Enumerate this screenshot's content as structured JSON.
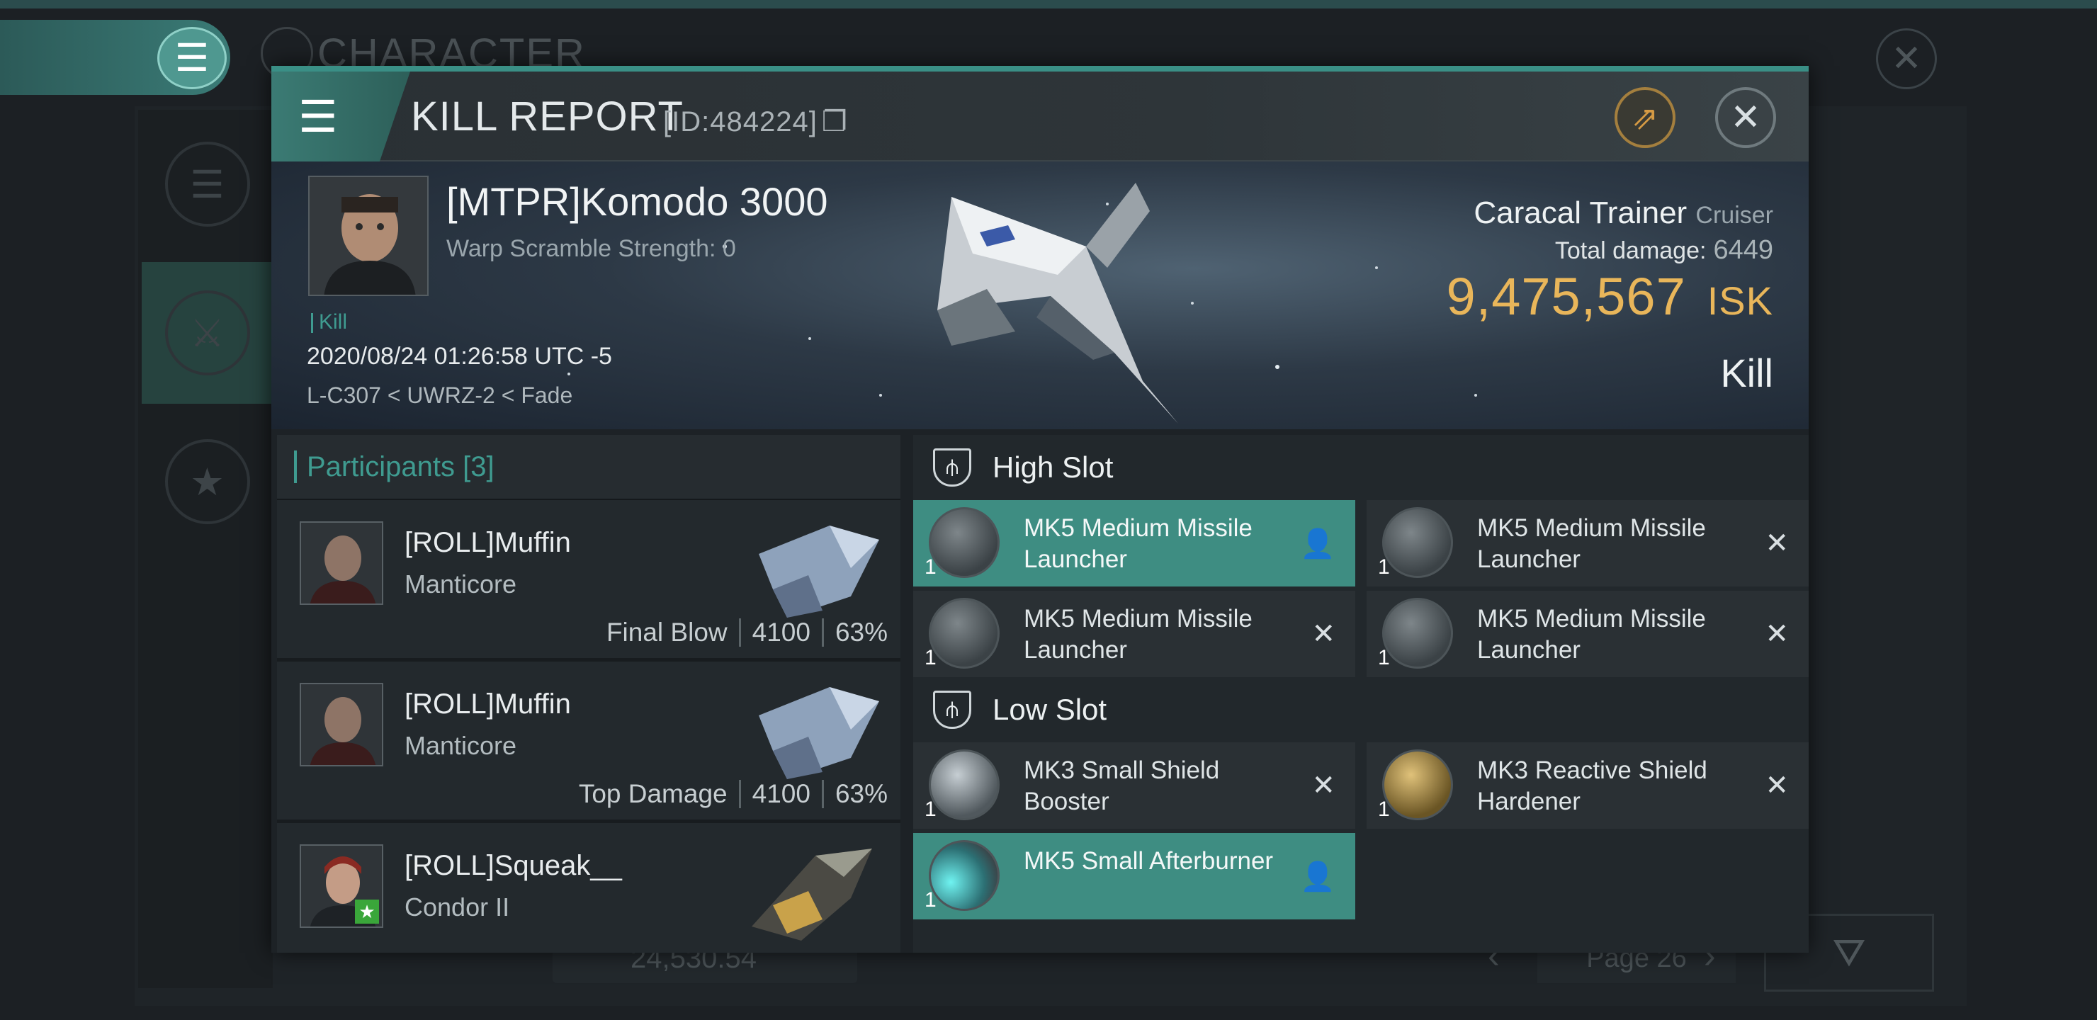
{
  "background": {
    "title": "CHARACTER",
    "isk_value": "24,530.54",
    "page_label": "Page 26"
  },
  "dialog": {
    "title": "KILL REPORT",
    "id_label": "[ID:484224]"
  },
  "victim": {
    "name": "[MTPR]Komodo 3000",
    "warp_scramble": "Warp Scramble Strength: 0",
    "kill_tag": "Kill",
    "datetime": "2020/08/24 01:26:58 UTC -5",
    "location": "L-C307 < UWRZ-2 < Fade",
    "ship_name": "Caracal Trainer",
    "ship_class": "Cruiser",
    "total_damage_label": "Total damage:",
    "total_damage": "6449",
    "isk_value": "9,475,567",
    "isk_unit": "ISK",
    "report_type": "Kill"
  },
  "participants": {
    "label": "Participants",
    "count": "[3]",
    "rows": [
      {
        "name": "[ROLL]Muffin",
        "ship": "Manticore",
        "role": "Final Blow",
        "damage": "4100",
        "percent": "63%"
      },
      {
        "name": "[ROLL]Muffin",
        "ship": "Manticore",
        "role": "Top Damage",
        "damage": "4100",
        "percent": "63%"
      },
      {
        "name": "[ROLL]Squeak__",
        "ship": "Condor II",
        "role": "",
        "damage": "",
        "percent": ""
      }
    ]
  },
  "fitting": {
    "high_slot_label": "High Slot",
    "low_slot_label": "Low Slot",
    "high": [
      {
        "name": "MK5 Medium Missile Launcher",
        "qty": "1",
        "status": "person-icon"
      },
      {
        "name": "MK5 Medium Missile Launcher",
        "qty": "1",
        "status": "close-icon"
      },
      {
        "name": "MK5 Medium Missile Launcher",
        "qty": "1",
        "status": "close-icon"
      },
      {
        "name": "MK5 Medium Missile Launcher",
        "qty": "1",
        "status": "close-icon"
      }
    ],
    "low": [
      {
        "name": "MK3 Small Shield Booster",
        "qty": "1",
        "status": "close-icon"
      },
      {
        "name": "MK3 Reactive Shield Hardener",
        "qty": "1",
        "status": "close-icon"
      },
      {
        "name": "MK5 Small Afterburner",
        "qty": "1",
        "status": "person-icon"
      }
    ]
  },
  "colors": {
    "accent": "#3f9b90",
    "isk": "#e9b65a",
    "active_module": "#3e8d82"
  }
}
